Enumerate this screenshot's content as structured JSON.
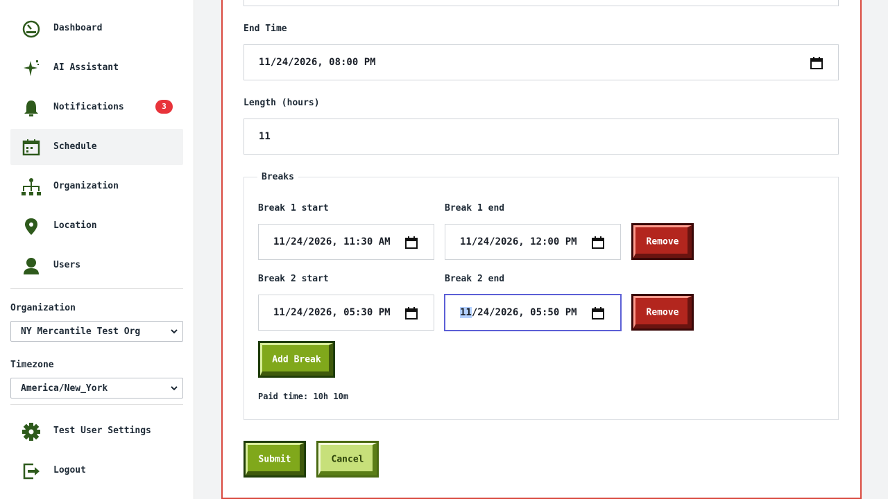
{
  "sidebar": {
    "items": [
      {
        "label": "Dashboard",
        "icon": "dashboard-icon"
      },
      {
        "label": "AI Assistant",
        "icon": "sparkle-icon"
      },
      {
        "label": "Notifications",
        "icon": "bell-icon",
        "badge": "3"
      },
      {
        "label": "Schedule",
        "icon": "calendar-icon",
        "active": true
      },
      {
        "label": "Organization",
        "icon": "org-chart-icon"
      },
      {
        "label": "Location",
        "icon": "map-pin-icon"
      },
      {
        "label": "Users",
        "icon": "user-icon"
      }
    ],
    "organization": {
      "label": "Organization",
      "value": "NY Mercantile Test Org"
    },
    "timezone": {
      "label": "Timezone",
      "value": "America/New_York"
    },
    "settings": {
      "label": "Test User Settings",
      "icon": "gear-icon"
    },
    "logout": {
      "label": "Logout",
      "icon": "logout-icon"
    }
  },
  "form": {
    "end_time": {
      "label": "End Time",
      "value": "11/24/2026, 08:00 PM"
    },
    "length": {
      "label": "Length (hours)",
      "value": "11"
    },
    "breaks": {
      "legend": "Breaks",
      "items": [
        {
          "start_label": "Break 1 start",
          "start_value": "11/24/2026, 11:30 AM",
          "end_label": "Break 1 end",
          "end_value": "11/24/2026, 12:00 PM",
          "remove_label": "Remove"
        },
        {
          "start_label": "Break 2 start",
          "start_value": "11/24/2026, 05:30 PM",
          "end_label": "Break 2 end",
          "end_value_sel": "11",
          "end_value_rest": "/24/2026, 05:50 PM",
          "remove_label": "Remove"
        }
      ],
      "add_label": "Add Break",
      "paid_time": "Paid time: 10h 10m"
    },
    "submit_label": "Submit",
    "cancel_label": "Cancel"
  },
  "colors": {
    "accent_green": "#80a81b",
    "danger_red": "#b3261e",
    "card_border": "#d9493f",
    "icon_green": "#2e5a1c",
    "badge_red": "#e8333a",
    "focus_blue": "#5b5fd6"
  }
}
